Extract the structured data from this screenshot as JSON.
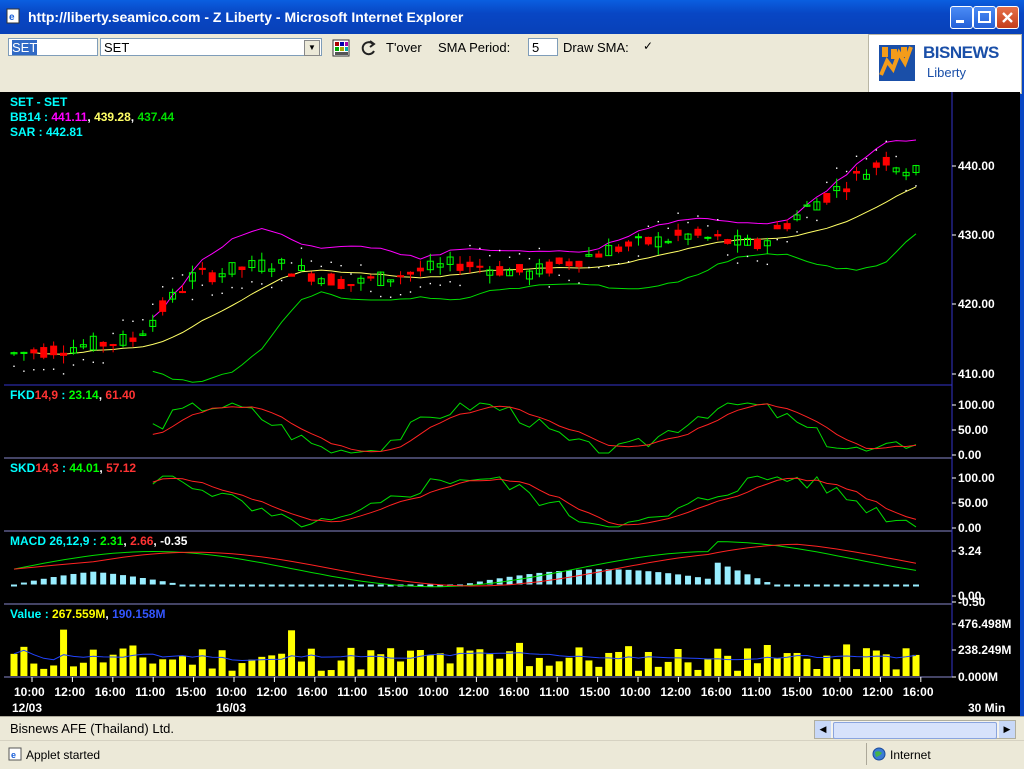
{
  "window": {
    "title": "http://liberty.seamico.com - Z Liberty - Microsoft Internet Explorer"
  },
  "toolbar": {
    "symbol_input": "SET",
    "symbol_select": "SET",
    "tover_label": "T'over",
    "sma_period_label": "SMA Period:",
    "sma_period_value": "5",
    "draw_sma_label": "Draw SMA:",
    "draw_sma_checked": "✓"
  },
  "logo": {
    "brand": "BISNEWS",
    "sub": "Liberty"
  },
  "icons": [
    "line-style-icon",
    "dropdown-arrow-icon",
    "export-icon",
    "save-icon",
    "print-icon",
    "indicator-icon",
    "chain-icon",
    "dy-icon",
    "zoom-box-icon",
    "crosshair-icon",
    "zoom-in-icon",
    "zoom-out-icon",
    "trend-line-icon",
    "horizontal-line-icon",
    "vertical-line-icon",
    "channel-icon",
    "arc-icon",
    "fan-icon",
    "speed-line-icon",
    "fibonacci-icon",
    "fib-fan-icon",
    "cycle-icon",
    "select-icon",
    "copy-icon",
    "delete-icon",
    "hand-icon",
    "help-icon"
  ],
  "panels": {
    "main": {
      "title": "SET - SET",
      "bb_label": "BB14 : ",
      "bb_upper": "441.11",
      "bb_mid": "439.28",
      "bb_lower": "437.44",
      "sar_label": "SAR : 442.81",
      "yticks": [
        "440.00",
        "430.00",
        "420.00",
        "410.00"
      ]
    },
    "fkd": {
      "name": "FKD",
      "params": "14,9",
      "sep": " : ",
      "v1": "23.14",
      "v2": "61.40",
      "yticks": [
        "100.00",
        "50.00",
        "0.00"
      ]
    },
    "skd": {
      "name": "SKD",
      "params": "14,3",
      "sep": " : ",
      "v1": "44.01",
      "v2": "57.12",
      "yticks": [
        "100.00",
        "50.00",
        "0.00"
      ]
    },
    "macd": {
      "name": "MACD 26,12,9 : ",
      "v1": "2.31",
      "v2": "2.66",
      "v3": "-0.35",
      "yticks": [
        "3.24",
        "0.00",
        "-0.50"
      ]
    },
    "value": {
      "name": "Value : ",
      "v1": "267.559M",
      "v2": "190.158M",
      "yticks": [
        "476.498M",
        "238.249M",
        "0.000M"
      ]
    }
  },
  "xaxis": {
    "ticks": [
      "10:00",
      "12:00",
      "16:00",
      "11:00",
      "15:00",
      "10:00",
      "12:00",
      "16:00",
      "11:00",
      "15:00",
      "10:00",
      "12:00",
      "16:00",
      "11:00",
      "15:00",
      "10:00",
      "12:00",
      "16:00",
      "11:00",
      "15:00",
      "10:00",
      "12:00",
      "16:00"
    ],
    "dates": [
      "12/03",
      "16/03"
    ],
    "interval": "30 Min"
  },
  "status": {
    "company": "Bisnews AFE (Thailand) Ltd.",
    "applet": "Applet started",
    "zone": "Internet"
  },
  "colors": {
    "up": "#00ff00",
    "down": "#ff0000",
    "bb_upper": "#ff00ff",
    "bb_mid": "#ffff66",
    "bb_lower": "#00dd00",
    "sar": "#ffffff",
    "value_bar": "#ffff00",
    "macd_hist": "#99eeff"
  }
}
